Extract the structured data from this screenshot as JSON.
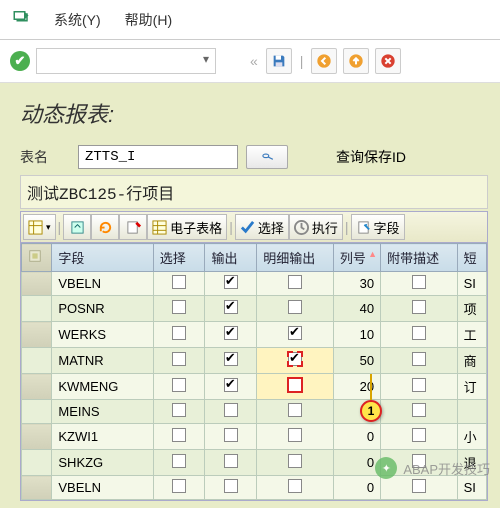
{
  "menu": {
    "system": "系统(Y)",
    "help": "帮助(H)"
  },
  "toolbar1": {
    "back_symbol": "«"
  },
  "title": "动态报表:",
  "form": {
    "table_label": "表名",
    "table_value": "ZTTS_I",
    "query_label": "查询保存ID"
  },
  "subtitle": "测试ZBC125-行项目",
  "grid_toolbar": {
    "spreadsheet": "电子表格",
    "select": "选择",
    "execute": "执行",
    "fields": "字段"
  },
  "columns": {
    "field": "字段",
    "select": "选择",
    "output": "输出",
    "detail_output": "明细输出",
    "seq": "列号",
    "desc": "附带描述",
    "short": "短"
  },
  "rows": [
    {
      "field": "VBELN",
      "select": false,
      "output": true,
      "detail": false,
      "seq": 30,
      "short": "SI",
      "hl": ""
    },
    {
      "field": "POSNR",
      "select": false,
      "output": true,
      "detail": false,
      "seq": 40,
      "short": "项",
      "hl": ""
    },
    {
      "field": "WERKS",
      "select": false,
      "output": true,
      "detail": true,
      "seq": 10,
      "short": "工",
      "hl": ""
    },
    {
      "field": "MATNR",
      "select": false,
      "output": true,
      "detail": true,
      "seq": 50,
      "short": "商",
      "hl": "dashed"
    },
    {
      "field": "KWMENG",
      "select": false,
      "output": true,
      "detail": false,
      "seq": 20,
      "short": "订",
      "hl": "solid"
    },
    {
      "field": "MEINS",
      "select": false,
      "output": false,
      "detail": false,
      "seq": 0,
      "short": "",
      "hl": ""
    },
    {
      "field": "KZWI1",
      "select": false,
      "output": false,
      "detail": false,
      "seq": 0,
      "short": "小",
      "hl": ""
    },
    {
      "field": "SHKZG",
      "select": false,
      "output": false,
      "detail": false,
      "seq": 0,
      "short": "退",
      "hl": ""
    },
    {
      "field": "VBELN",
      "select": false,
      "output": false,
      "detail": false,
      "seq": 0,
      "short": "SI",
      "hl": ""
    }
  ],
  "callout": {
    "num": "1"
  },
  "watermark": "ABAP开发技巧"
}
